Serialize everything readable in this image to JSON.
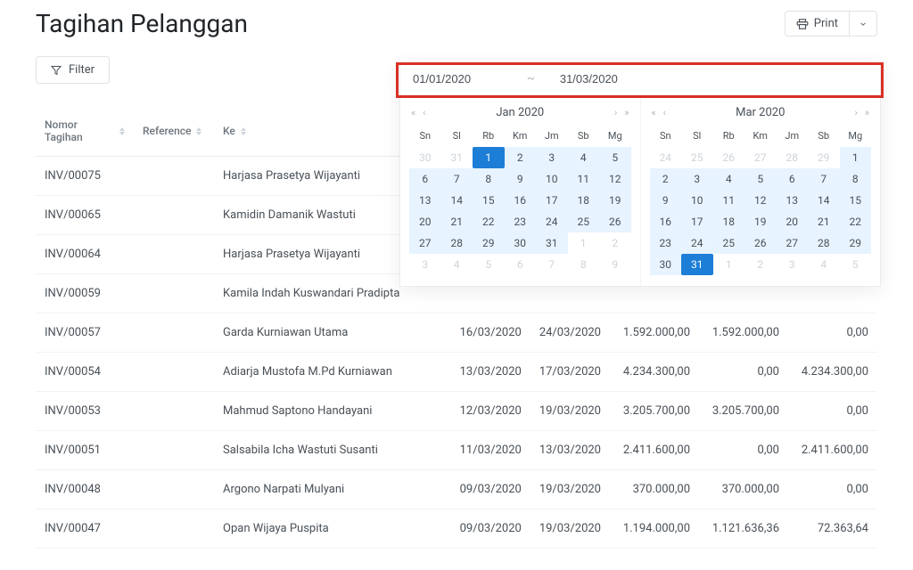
{
  "header": {
    "title": "Tagihan Pelanggan",
    "print": "Print"
  },
  "toolbar": {
    "filter": "Filter"
  },
  "daterange": {
    "start": "01/01/2020",
    "end": "31/03/2020",
    "sep": "~"
  },
  "calendars": {
    "dow": [
      "Sn",
      "Sl",
      "Rb",
      "Km",
      "Jm",
      "Sb",
      "Mg"
    ],
    "left": {
      "title": "Jan 2020",
      "days": [
        {
          "n": 30,
          "muted": true
        },
        {
          "n": 31,
          "muted": true
        },
        {
          "n": 1,
          "sel": true
        },
        {
          "n": 2,
          "range": true
        },
        {
          "n": 3,
          "range": true
        },
        {
          "n": 4,
          "range": true
        },
        {
          "n": 5,
          "range": true
        },
        {
          "n": 6,
          "range": true
        },
        {
          "n": 7,
          "range": true
        },
        {
          "n": 8,
          "range": true
        },
        {
          "n": 9,
          "range": true
        },
        {
          "n": 10,
          "range": true
        },
        {
          "n": 11,
          "range": true
        },
        {
          "n": 12,
          "range": true
        },
        {
          "n": 13,
          "range": true
        },
        {
          "n": 14,
          "range": true
        },
        {
          "n": 15,
          "range": true
        },
        {
          "n": 16,
          "range": true
        },
        {
          "n": 17,
          "range": true
        },
        {
          "n": 18,
          "range": true
        },
        {
          "n": 19,
          "range": true
        },
        {
          "n": 20,
          "range": true
        },
        {
          "n": 21,
          "range": true
        },
        {
          "n": 22,
          "range": true
        },
        {
          "n": 23,
          "range": true
        },
        {
          "n": 24,
          "range": true
        },
        {
          "n": 25,
          "range": true
        },
        {
          "n": 26,
          "range": true
        },
        {
          "n": 27,
          "range": true
        },
        {
          "n": 28,
          "range": true
        },
        {
          "n": 29,
          "range": true
        },
        {
          "n": 30,
          "range": true
        },
        {
          "n": 31,
          "range": true
        },
        {
          "n": 1,
          "muted": true
        },
        {
          "n": 2,
          "muted": true
        },
        {
          "n": 3,
          "muted": true
        },
        {
          "n": 4,
          "muted": true
        },
        {
          "n": 5,
          "muted": true
        },
        {
          "n": 6,
          "muted": true
        },
        {
          "n": 7,
          "muted": true
        },
        {
          "n": 8,
          "muted": true
        },
        {
          "n": 9,
          "muted": true
        }
      ]
    },
    "right": {
      "title": "Mar 2020",
      "days": [
        {
          "n": 24,
          "muted": true
        },
        {
          "n": 25,
          "muted": true
        },
        {
          "n": 26,
          "muted": true
        },
        {
          "n": 27,
          "muted": true
        },
        {
          "n": 28,
          "muted": true
        },
        {
          "n": 29,
          "muted": true
        },
        {
          "n": 1,
          "range": true
        },
        {
          "n": 2,
          "range": true
        },
        {
          "n": 3,
          "range": true
        },
        {
          "n": 4,
          "range": true
        },
        {
          "n": 5,
          "range": true
        },
        {
          "n": 6,
          "range": true
        },
        {
          "n": 7,
          "range": true
        },
        {
          "n": 8,
          "range": true
        },
        {
          "n": 9,
          "range": true
        },
        {
          "n": 10,
          "range": true
        },
        {
          "n": 11,
          "range": true
        },
        {
          "n": 12,
          "range": true
        },
        {
          "n": 13,
          "range": true
        },
        {
          "n": 14,
          "range": true
        },
        {
          "n": 15,
          "range": true
        },
        {
          "n": 16,
          "range": true
        },
        {
          "n": 17,
          "range": true
        },
        {
          "n": 18,
          "range": true
        },
        {
          "n": 19,
          "range": true
        },
        {
          "n": 20,
          "range": true
        },
        {
          "n": 21,
          "range": true
        },
        {
          "n": 22,
          "range": true
        },
        {
          "n": 23,
          "range": true
        },
        {
          "n": 24,
          "range": true
        },
        {
          "n": 25,
          "range": true
        },
        {
          "n": 26,
          "range": true
        },
        {
          "n": 27,
          "range": true
        },
        {
          "n": 28,
          "range": true
        },
        {
          "n": 29,
          "range": true
        },
        {
          "n": 30,
          "range": true
        },
        {
          "n": 31,
          "sel": true
        },
        {
          "n": 1,
          "muted": true
        },
        {
          "n": 2,
          "muted": true
        },
        {
          "n": 3,
          "muted": true
        },
        {
          "n": 4,
          "muted": true
        },
        {
          "n": 5,
          "muted": true
        }
      ]
    }
  },
  "columns": [
    "Nomor Tagihan",
    "Reference",
    "Ke",
    "",
    "",
    "",
    "",
    ""
  ],
  "rows": [
    {
      "no": "INV/00075",
      "ref": "",
      "ke": "Harjasa Prasetya Wijayanti",
      "d1": "",
      "d2": "",
      "v1": "",
      "v2": "",
      "v3": ""
    },
    {
      "no": "INV/00065",
      "ref": "",
      "ke": "Kamidin Damanik Wastuti",
      "d1": "",
      "d2": "",
      "v1": "",
      "v2": "",
      "v3": ""
    },
    {
      "no": "INV/00064",
      "ref": "",
      "ke": "Harjasa Prasetya Wijayanti",
      "d1": "",
      "d2": "",
      "v1": "",
      "v2": "",
      "v3": ""
    },
    {
      "no": "INV/00059",
      "ref": "",
      "ke": "Kamila Indah Kuswandari Pradipta",
      "d1": "",
      "d2": "",
      "v1": "",
      "v2": "",
      "v3": ""
    },
    {
      "no": "INV/00057",
      "ref": "",
      "ke": "Garda Kurniawan Utama",
      "d1": "16/03/2020",
      "d2": "24/03/2020",
      "v1": "1.592.000,00",
      "v2": "1.592.000,00",
      "v3": "0,00"
    },
    {
      "no": "INV/00054",
      "ref": "",
      "ke": "Adiarja Mustofa M.Pd Kurniawan",
      "d1": "13/03/2020",
      "d2": "17/03/2020",
      "v1": "4.234.300,00",
      "v2": "0,00",
      "v3": "4.234.300,00"
    },
    {
      "no": "INV/00053",
      "ref": "",
      "ke": "Mahmud Saptono Handayani",
      "d1": "12/03/2020",
      "d2": "19/03/2020",
      "v1": "3.205.700,00",
      "v2": "3.205.700,00",
      "v3": "0,00"
    },
    {
      "no": "INV/00051",
      "ref": "",
      "ke": "Salsabila Icha Wastuti Susanti",
      "d1": "11/03/2020",
      "d2": "13/03/2020",
      "v1": "2.411.600,00",
      "v2": "0,00",
      "v3": "2.411.600,00"
    },
    {
      "no": "INV/00048",
      "ref": "",
      "ke": "Argono Narpati Mulyani",
      "d1": "09/03/2020",
      "d2": "19/03/2020",
      "v1": "370.000,00",
      "v2": "370.000,00",
      "v3": "0,00"
    },
    {
      "no": "INV/00047",
      "ref": "",
      "ke": "Opan Wijaya Puspita",
      "d1": "09/03/2020",
      "d2": "19/03/2020",
      "v1": "1.194.000,00",
      "v2": "1.121.636,36",
      "v3": "72.363,64"
    }
  ]
}
